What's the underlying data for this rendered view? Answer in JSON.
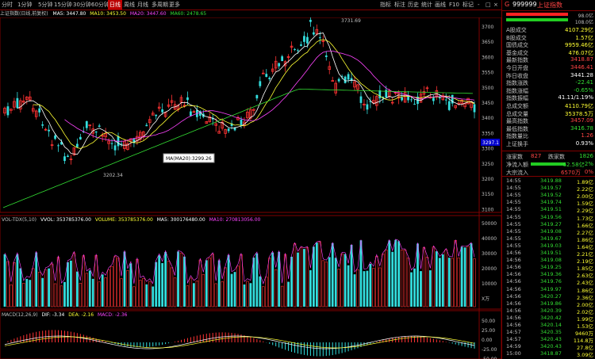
{
  "toolbar": {
    "left_items": [
      "分时",
      "1分钟",
      "5分钟",
      "15分钟",
      "30分钟",
      "60分钟",
      "日线",
      "周线",
      "月线",
      "多周期",
      "更多"
    ],
    "active_item": "日线",
    "right_items": [
      "指标",
      "标注",
      "历史",
      "统计",
      "画线",
      "F10",
      "标记",
      "-",
      "□",
      "×"
    ]
  },
  "ma_line": {
    "title": "上证指数(日线,前复权)",
    "ma5": "MA5: 3447.80",
    "ma10": "MA10: 3453.50",
    "ma20": "MA20: 3447.60",
    "ma60": "MA60: 2478.65"
  },
  "annotations": {
    "high_label": "3731.69",
    "low_label": "3202.34",
    "tooltip": "MA(MA20):3299.26",
    "current_price_tag": "3297.1"
  },
  "price_axis": [
    "3700",
    "3650",
    "3600",
    "3550",
    "3500",
    "3450",
    "3400",
    "3350",
    "3300",
    "3250",
    "3200",
    "3150",
    "3100"
  ],
  "volume_header": {
    "label": "VOL-TDX(5,10)",
    "vvol": "VVOL: 353785376.00",
    "volume": "VOLUME: 353785376.00",
    "ma5": "MA5: 300176480.00",
    "ma10": "MA10: 270813056.00"
  },
  "volume_axis": [
    "50000",
    "40000",
    "30000",
    "20000",
    "10000",
    "X万"
  ],
  "macd_header": {
    "label": "MACD(12,26,9)",
    "dif": "DIF: -3.34",
    "dea": "DEA: -2.16",
    "macd": "MACD: -2.36"
  },
  "macd_axis": [
    "50.00",
    "25.00",
    "0.00",
    "-25.00",
    "-50.00"
  ],
  "colors": {
    "up": "#ff3333",
    "down": "#33dddd",
    "ma5": "#ffffff",
    "ma10": "#ffff33",
    "ma20": "#ff44ff",
    "ma60": "#33dd33",
    "border": "#800000"
  },
  "right_panel": {
    "code_label": "G",
    "code": "999999",
    "name": "上证指数",
    "bar_values": [
      "98.0亿",
      "108.0亿"
    ],
    "stats": [
      {
        "label": "A股成交",
        "value": "4107.29亿",
        "cls": "yellow"
      },
      {
        "label": "B股成交",
        "value": "1.57亿",
        "cls": "yellow"
      },
      {
        "label": "国债成交",
        "value": "9959.46亿",
        "cls": "yellow"
      },
      {
        "label": "基金成交",
        "value": "476.07亿",
        "cls": "yellow"
      },
      {
        "label": "最新指数",
        "value": "3418.87",
        "cls": "red"
      },
      {
        "label": "今日开盘",
        "value": "3446.41",
        "cls": "red"
      },
      {
        "label": "昨日收盘",
        "value": "3441.28",
        "cls": "white"
      },
      {
        "label": "指数涨跌",
        "value": "-22.41",
        "cls": "green"
      },
      {
        "label": "指数涨幅",
        "value": "-0.65%",
        "cls": "green"
      },
      {
        "label": "指数振幅",
        "value": "41.11/1.19%",
        "cls": "white"
      },
      {
        "label": "总成交额",
        "value": "4110.79亿",
        "cls": "yellow"
      },
      {
        "label": "总成交量",
        "value": "35378.5万",
        "cls": "yellow"
      },
      {
        "label": "最高指数",
        "value": "3457.09",
        "cls": "red"
      },
      {
        "label": "最低指数",
        "value": "3416.78",
        "cls": "green"
      },
      {
        "label": "指数量比",
        "value": "1.26",
        "cls": "red"
      },
      {
        "label": "上证换手",
        "value": "0.93%",
        "cls": "white"
      }
    ],
    "up_label": "涨家数",
    "up_count": "827",
    "down_label": "跌家数",
    "down_count": "1826",
    "inflow_label": "净流入额",
    "inflow_value": "-62.58亿",
    "inflow_pct": "-2%",
    "bulk_label": "大宗流入",
    "bulk_value": "6570万",
    "bulk_pct": "0%",
    "ticks": [
      {
        "time": "14:55",
        "price": "3419.88",
        "vol": "1.89亿"
      },
      {
        "time": "14:55",
        "price": "3419.57",
        "vol": "2.22亿"
      },
      {
        "time": "14:55",
        "price": "3419.52",
        "vol": "2.00亿"
      },
      {
        "time": "14:55",
        "price": "3419.74",
        "vol": "1.59亿"
      },
      {
        "time": "14:55",
        "price": "3419.51",
        "vol": "2.29亿"
      },
      {
        "time": "14:55",
        "price": "3419.56",
        "vol": "1.73亿"
      },
      {
        "time": "14:55",
        "price": "3419.27",
        "vol": "1.66亿"
      },
      {
        "time": "14:55",
        "price": "3419.08",
        "vol": "2.27亿"
      },
      {
        "time": "14:55",
        "price": "3419.67",
        "vol": "1.86亿"
      },
      {
        "time": "14:55",
        "price": "3419.03",
        "vol": "1.64亿"
      },
      {
        "time": "14:56",
        "price": "3419.51",
        "vol": "2.21亿"
      },
      {
        "time": "14:56",
        "price": "3419.08",
        "vol": "2.19亿"
      },
      {
        "time": "14:56",
        "price": "3419.25",
        "vol": "1.85亿"
      },
      {
        "time": "14:56",
        "price": "3419.36",
        "vol": "2.63亿"
      },
      {
        "time": "14:56",
        "price": "3419.76",
        "vol": "2.43亿"
      },
      {
        "time": "14:56",
        "price": "3419.97",
        "vol": "1.86亿"
      },
      {
        "time": "14:56",
        "price": "3420.27",
        "vol": "2.36亿"
      },
      {
        "time": "14:56",
        "price": "3419.86",
        "vol": "2.00亿"
      },
      {
        "time": "14:56",
        "price": "3420.39",
        "vol": "2.02亿"
      },
      {
        "time": "14:56",
        "price": "3420.42",
        "vol": "1.99亿"
      },
      {
        "time": "14:56",
        "price": "3420.14",
        "vol": "1.53亿"
      },
      {
        "time": "14:57",
        "price": "3420.35",
        "vol": "9460万"
      },
      {
        "time": "14:57",
        "price": "3420.43",
        "vol": "114.8万"
      },
      {
        "time": "14:59",
        "price": "3420.43",
        "vol": "27.8亿"
      },
      {
        "time": "15:00",
        "price": "3418.87",
        "vol": "3.09亿"
      }
    ]
  }
}
